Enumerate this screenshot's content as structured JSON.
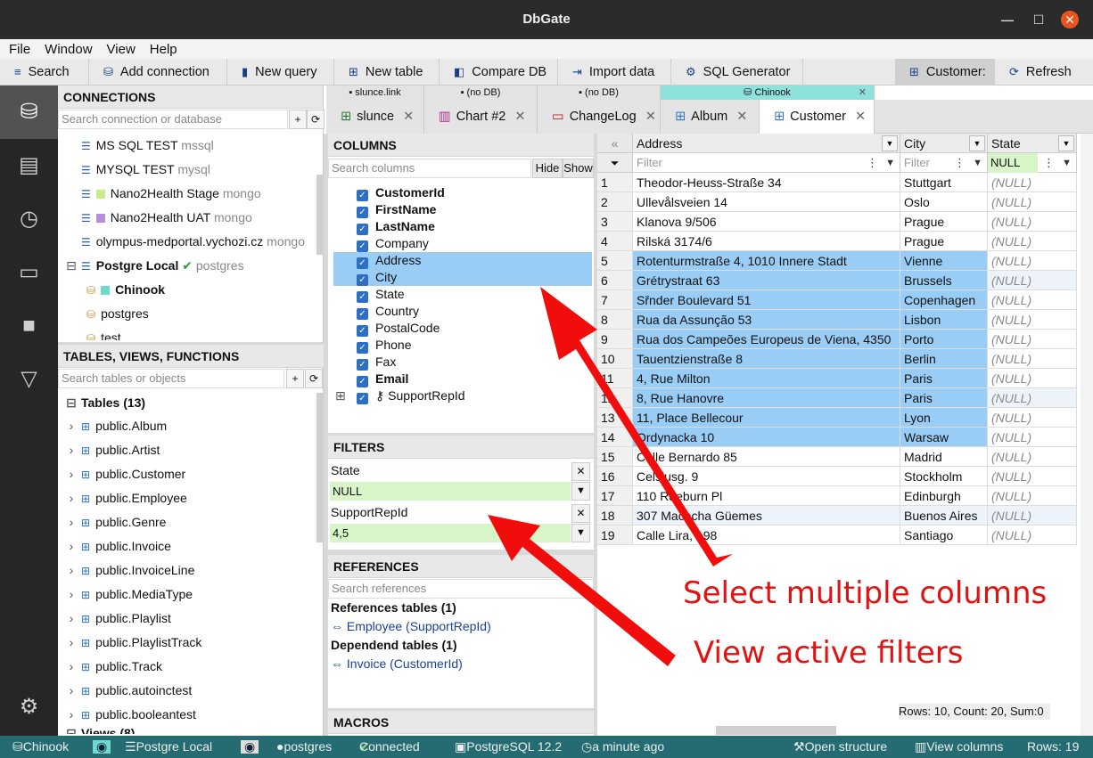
{
  "app": {
    "title": "DbGate"
  },
  "menu": [
    "File",
    "Window",
    "View",
    "Help"
  ],
  "toolbar": {
    "search": "Search",
    "add_connection": "Add connection",
    "new_query": "New query",
    "new_table": "New table",
    "compare_db": "Compare DB",
    "import_data": "Import data",
    "sql_generator": "SQL Generator",
    "customer": "Customer:",
    "refresh": "Refresh"
  },
  "connections": {
    "header": "CONNECTIONS",
    "search_placeholder": "Search connection or database",
    "items": [
      {
        "name": "MS SQL TEST",
        "engine": "mssql"
      },
      {
        "name": "MYSQL TEST",
        "engine": "mysql"
      },
      {
        "name": "Nano2Health Stage",
        "engine": "mongo",
        "color": "#c8ec8a"
      },
      {
        "name": "Nano2Health UAT",
        "engine": "mongo",
        "color": "#b58ee0"
      },
      {
        "name": "olympus-medportal.vychozi.cz",
        "engine": "mongo"
      },
      {
        "name": "Postgre Local",
        "engine": "postgres"
      },
      {
        "name": "Chinook",
        "color": "#6fd8d0"
      },
      {
        "name": "postgres"
      },
      {
        "name": "test"
      }
    ]
  },
  "objects": {
    "header": "TABLES, VIEWS, FUNCTIONS",
    "search_placeholder": "Search tables or objects",
    "tables_group": "Tables (13)",
    "views_group": "Views (8)",
    "tables": [
      "public.Album",
      "public.Artist",
      "public.Customer",
      "public.Employee",
      "public.Genre",
      "public.Invoice",
      "public.InvoiceLine",
      "public.MediaType",
      "public.Playlist",
      "public.PlaylistTrack",
      "public.Track",
      "public.autoinctest",
      "public.booleantest"
    ]
  },
  "tabs_top": [
    "slunce.link",
    "(no DB)",
    "(no DB)",
    "Chinook"
  ],
  "tabs": [
    "slunce",
    "Chart #2",
    "ChangeLog",
    "Album",
    "Customer"
  ],
  "columns": {
    "header": "COLUMNS",
    "search_placeholder": "Search columns",
    "hide": "Hide",
    "show": "Show",
    "items": [
      "CustomerId",
      "FirstName",
      "LastName",
      "Company",
      "Address",
      "City",
      "State",
      "Country",
      "PostalCode",
      "Phone",
      "Fax",
      "Email",
      "SupportRepId"
    ]
  },
  "filters": {
    "header": "FILTERS",
    "items": [
      {
        "column": "State",
        "value": "NULL"
      },
      {
        "column": "SupportRepId",
        "value": "4,5"
      }
    ]
  },
  "references": {
    "header": "REFERENCES",
    "search_placeholder": "Search references",
    "refs_title": "References tables (1)",
    "ref1": "Employee (SupportRepId)",
    "dep_title": "Dependend tables (1)",
    "dep1": "Invoice (CustomerId)"
  },
  "macros": {
    "header": "MACROS"
  },
  "grid": {
    "headers": [
      "Address",
      "City",
      "State"
    ],
    "filter_placeholder": "Filter",
    "state_filter": "NULL",
    "rows": [
      [
        "1",
        "Theodor-Heuss-Straße 34",
        "Stuttgart",
        "(NULL)"
      ],
      [
        "2",
        "Ullevålsveien 14",
        "Oslo",
        "(NULL)"
      ],
      [
        "3",
        "Klanova 9/506",
        "Prague",
        "(NULL)"
      ],
      [
        "4",
        "Rilská 3174/6",
        "Prague",
        "(NULL)"
      ],
      [
        "5",
        "Rotenturmstraße 4, 1010 Innere Stadt",
        "Vienne",
        "(NULL)"
      ],
      [
        "6",
        "Grétrystraat 63",
        "Brussels",
        "(NULL)"
      ],
      [
        "7",
        "Sřnder Boulevard 51",
        "Copenhagen",
        "(NULL)"
      ],
      [
        "8",
        "Rua da Assunção 53",
        "Lisbon",
        "(NULL)"
      ],
      [
        "9",
        "Rua dos Campeões Europeus de Viena, 4350",
        "Porto",
        "(NULL)"
      ],
      [
        "10",
        "Tauentzienstraße 8",
        "Berlin",
        "(NULL)"
      ],
      [
        "11",
        "4, Rue Milton",
        "Paris",
        "(NULL)"
      ],
      [
        "12",
        "8, Rue Hanovre",
        "Paris",
        "(NULL)"
      ],
      [
        "13",
        "11, Place Bellecour",
        "Lyon",
        "(NULL)"
      ],
      [
        "14",
        "Ordynacka 10",
        "Warsaw",
        "(NULL)"
      ],
      [
        "15",
        "Calle Bernardo 85",
        "Madrid",
        "(NULL)"
      ],
      [
        "16",
        "Celsiusg. 9",
        "Stockholm",
        "(NULL)"
      ],
      [
        "17",
        "110 Raeburn Pl",
        "Edinburgh",
        "(NULL)"
      ],
      [
        "18",
        "307 Macacha Güemes",
        "Buenos Aires",
        "(NULL)"
      ],
      [
        "19",
        "Calle Lira, 198",
        "Santiago",
        "(NULL)"
      ]
    ],
    "summary": "Rows: 10, Count: 20, Sum:0"
  },
  "annotations": {
    "a1": "Select multiple columns",
    "a2": "View active filters"
  },
  "status": {
    "db": "Chinook",
    "server": "Postgre Local",
    "user": "postgres",
    "connected": "Connected",
    "version": "PostgreSQL 12.2",
    "time": "a minute ago",
    "open_structure": "Open structure",
    "view_columns": "View columns",
    "rows": "Rows: 19"
  }
}
